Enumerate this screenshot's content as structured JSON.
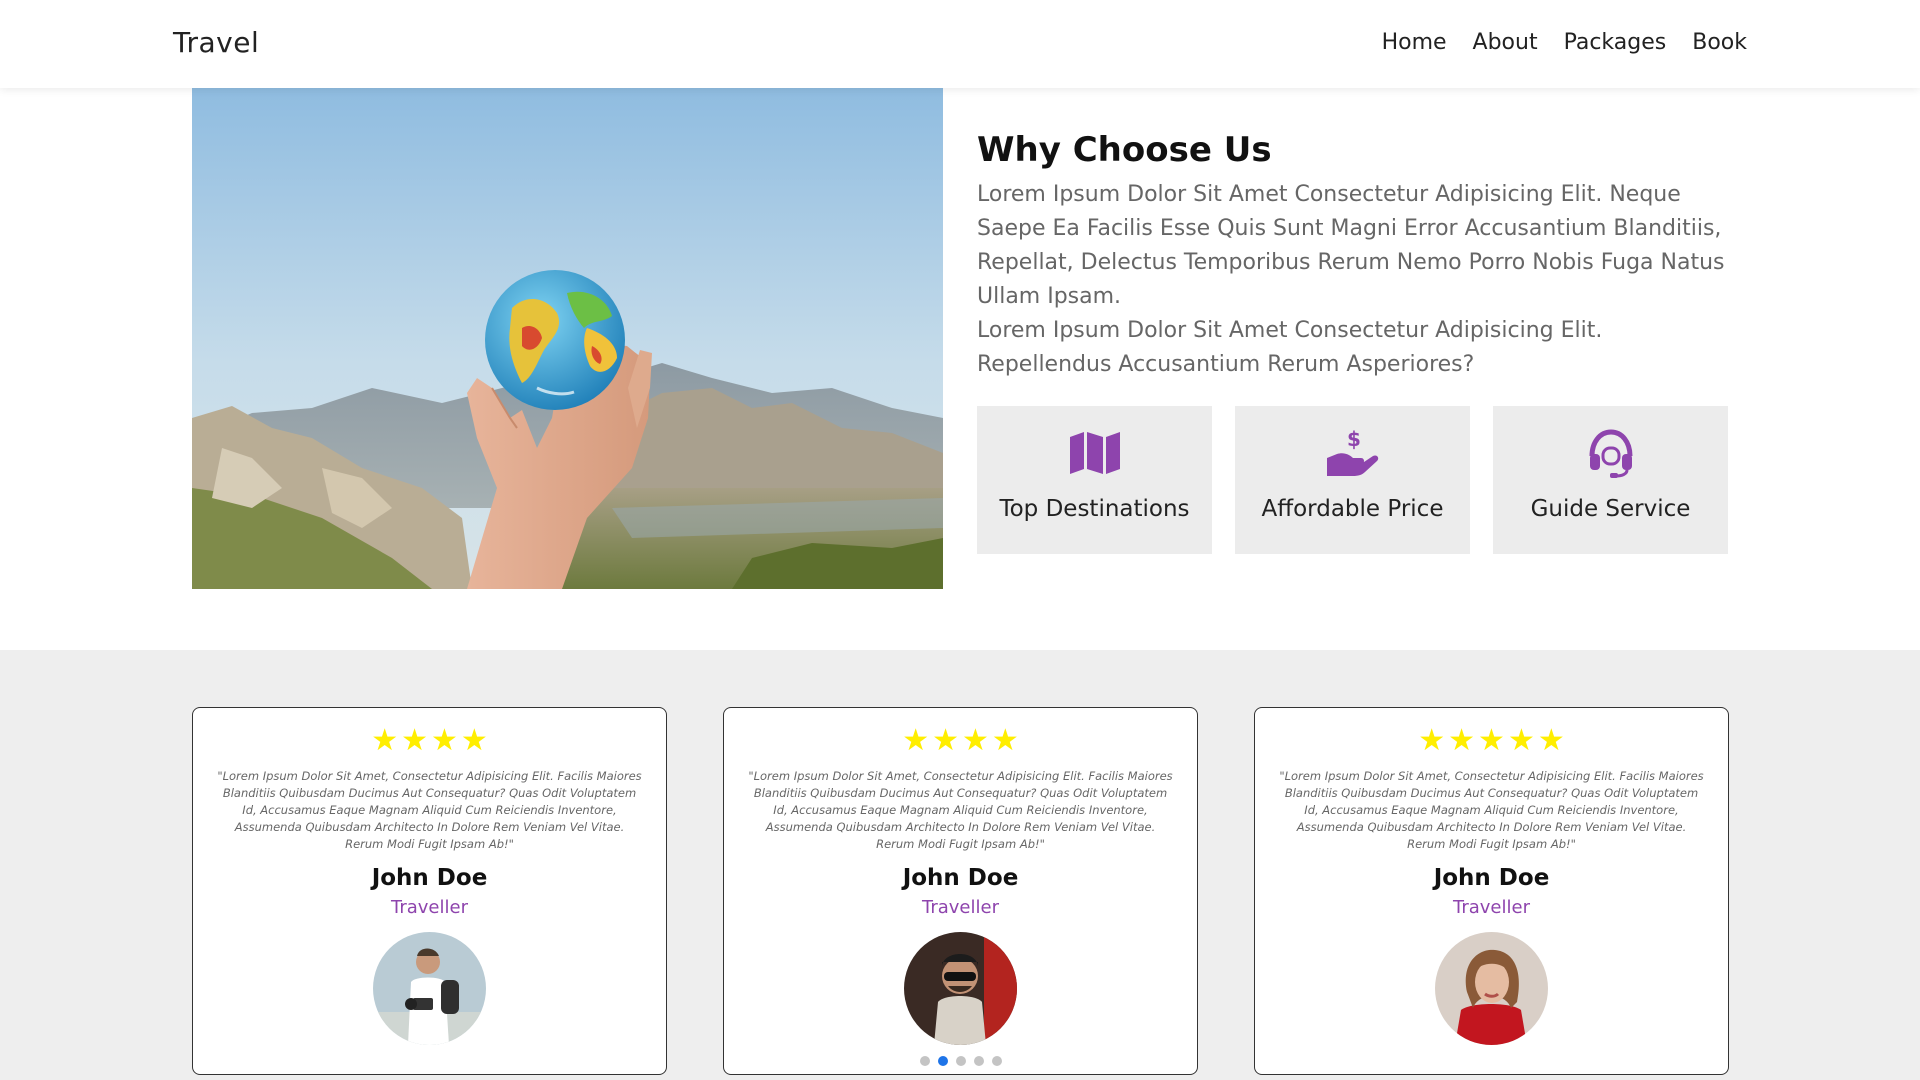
{
  "header": {
    "logo": "Travel",
    "nav": [
      "Home",
      "About",
      "Packages",
      "Book"
    ]
  },
  "why": {
    "title": "Why Choose Us",
    "paragraph1": "Lorem Ipsum Dolor Sit Amet Consectetur Adipisicing Elit. Neque Saepe Ea Facilis Esse Quis Sunt Magni Error Accusantium Blanditiis, Repellat, Delectus Temporibus Rerum Nemo Porro Nobis Fuga Natus Ullam Ipsam.",
    "paragraph2": "Lorem Ipsum Dolor Sit Amet Consectetur Adipisicing Elit. Repellendus Accusantium Rerum Asperiores?",
    "features": [
      {
        "label": "Top Destinations",
        "icon": "map-icon"
      },
      {
        "label": "Affordable Price",
        "icon": "hand-dollar-icon"
      },
      {
        "label": "Guide Service",
        "icon": "headset-icon"
      }
    ],
    "accent": "#8e44ad"
  },
  "testimonials": {
    "cards": [
      {
        "stars": 4,
        "quote": "\"Lorem Ipsum Dolor Sit Amet, Consectetur Adipisicing Elit. Facilis Maiores Blanditiis Quibusdam Ducimus Aut Consequatur? Quas Odit Voluptatem Id, Accusamus Eaque Magnam Aliquid Cum Reiciendis Inventore, Assumenda Quibusdam Architecto In Dolore Rem Veniam Vel Vitae. Rerum Modi Fugit Ipsam Ab!\"",
        "name": "John Doe",
        "role": "Traveller"
      },
      {
        "stars": 4,
        "quote": "\"Lorem Ipsum Dolor Sit Amet, Consectetur Adipisicing Elit. Facilis Maiores Blanditiis Quibusdam Ducimus Aut Consequatur? Quas Odit Voluptatem Id, Accusamus Eaque Magnam Aliquid Cum Reiciendis Inventore, Assumenda Quibusdam Architecto In Dolore Rem Veniam Vel Vitae. Rerum Modi Fugit Ipsam Ab!\"",
        "name": "John Doe",
        "role": "Traveller"
      },
      {
        "stars": 5,
        "quote": "\"Lorem Ipsum Dolor Sit Amet, Consectetur Adipisicing Elit. Facilis Maiores Blanditiis Quibusdam Ducimus Aut Consequatur? Quas Odit Voluptatem Id, Accusamus Eaque Magnam Aliquid Cum Reiciendis Inventore, Assumenda Quibusdam Architecto In Dolore Rem Veniam Vel Vitae. Rerum Modi Fugit Ipsam Ab!\"",
        "name": "John Doe",
        "role": "Traveller"
      }
    ],
    "pagination": {
      "count": 5,
      "active": 2
    },
    "star_color": "#ffee00",
    "dot_active_color": "#1e74e8"
  }
}
